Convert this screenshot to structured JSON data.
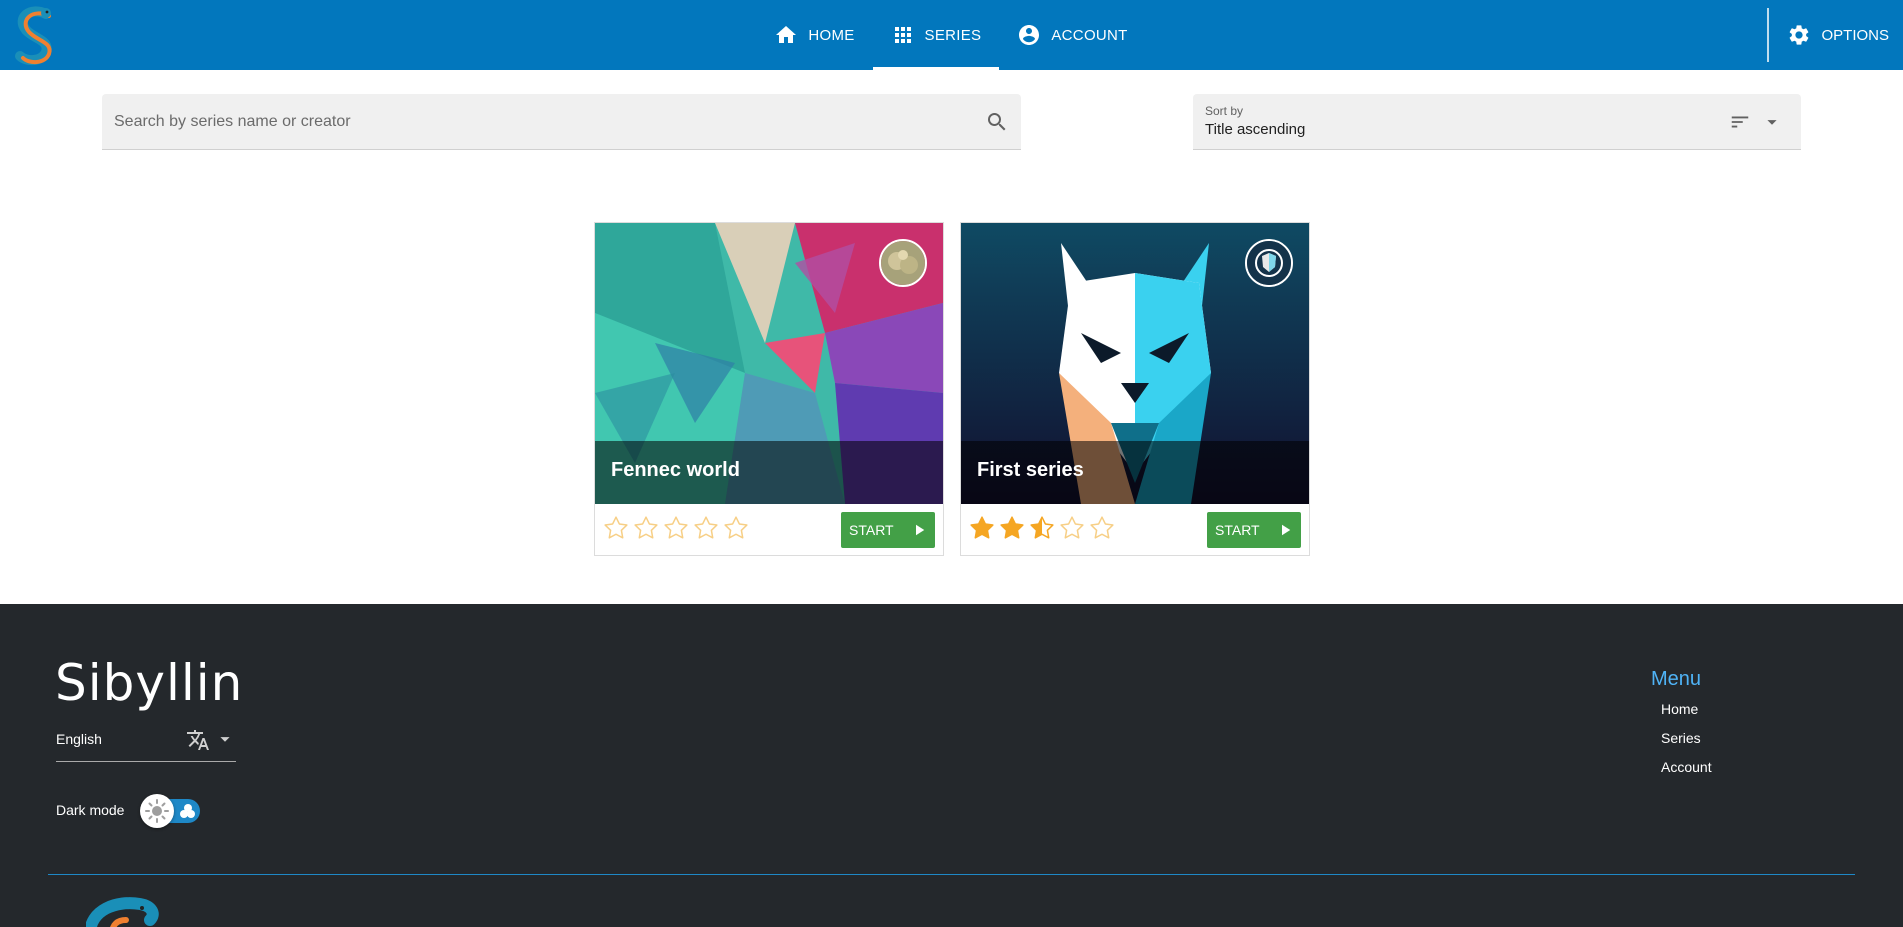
{
  "header": {
    "nav": [
      {
        "label": "HOME",
        "icon": "home-icon"
      },
      {
        "label": "SERIES",
        "icon": "apps-grid-icon",
        "active": true
      },
      {
        "label": "ACCOUNT",
        "icon": "account-circle-icon"
      }
    ],
    "options_label": "OPTIONS",
    "colors": {
      "bar": "#0277bd"
    }
  },
  "search": {
    "placeholder": "Search by series name or creator",
    "value": ""
  },
  "sort": {
    "label": "Sort by",
    "value": "Title ascending"
  },
  "series": [
    {
      "title": "Fennec world",
      "rating": 0,
      "max_rating": 5,
      "start_label": "START"
    },
    {
      "title": "First series",
      "rating": 2.5,
      "max_rating": 5,
      "start_label": "START"
    }
  ],
  "footer": {
    "brand": "Sibyllin",
    "language": "English",
    "dark_mode_label": "Dark mode",
    "dark_mode_on": false,
    "menu_title": "Menu",
    "menu_items": [
      "Home",
      "Series",
      "Account"
    ],
    "colors": {
      "background": "#24282c",
      "accent": "#4fb3f6",
      "start_button": "#43a047",
      "star": "#f5a623"
    }
  }
}
